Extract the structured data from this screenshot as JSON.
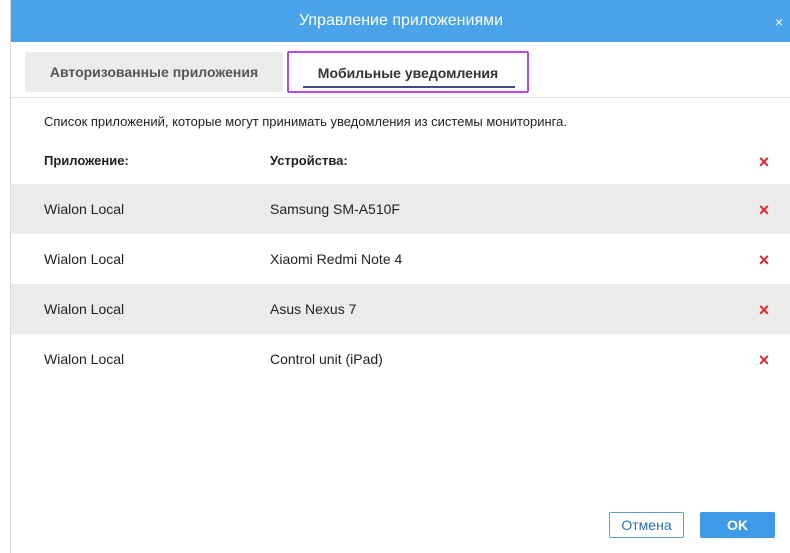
{
  "dialog": {
    "title": "Управление приложениями",
    "close_glyph": "×"
  },
  "tabs": [
    {
      "label": "Авторизованные приложения",
      "active": false
    },
    {
      "label": "Мобильные уведомления",
      "active": true
    }
  ],
  "description": "Список приложений, которые могут принимать уведомления из системы мониторинга.",
  "table": {
    "columns": [
      "Приложение:",
      "Устройства:"
    ],
    "delete_glyph": "×",
    "rows": [
      {
        "app": "Wialon Local",
        "device": "Samsung SM-A510F"
      },
      {
        "app": "Wialon Local",
        "device": "Xiaomi Redmi Note 4"
      },
      {
        "app": "Wialon Local",
        "device": "Asus Nexus 7"
      },
      {
        "app": "Wialon Local",
        "device": "Control unit (iPad)"
      }
    ]
  },
  "footer": {
    "cancel_label": "Отмена",
    "ok_label": "OK"
  },
  "colors": {
    "titlebar": "#4aa3e8",
    "active_tab_outline": "#b54be0",
    "delete": "#e0262a",
    "ok_button": "#3d9ae8"
  }
}
